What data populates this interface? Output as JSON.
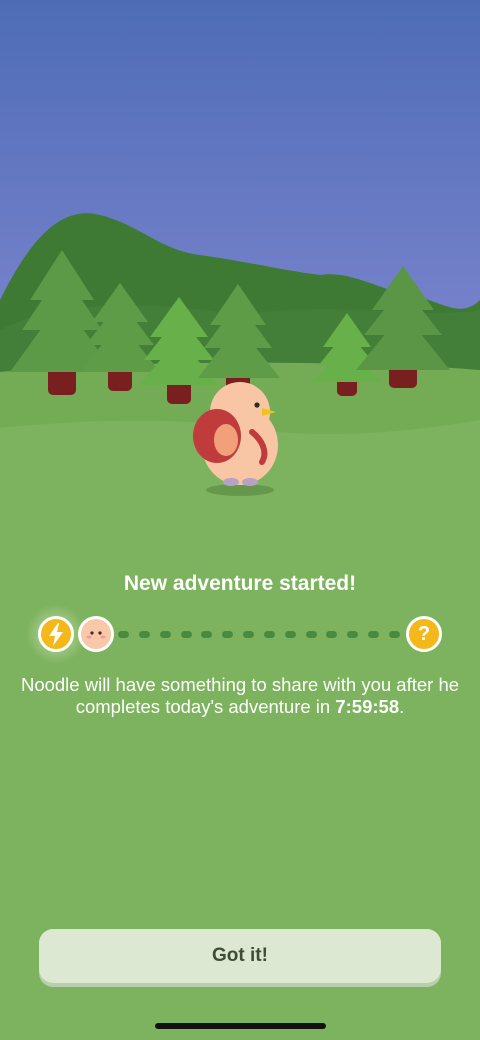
{
  "colors": {
    "sky_top": "#4f6eb8",
    "sky_bottom": "#8c8fd6",
    "hills": "#3d7a35",
    "grass": "#7db35e",
    "accent_yellow": "#f4b81a",
    "chick": "#f8c8a8",
    "backpack": "#c03c3c"
  },
  "adventure": {
    "title": "New adventure started!",
    "message_prefix": "Noodle will have something to share with you after he completes today's adventure in ",
    "timer": "7:59:58",
    "message_suffix": ".",
    "start_icon": "lightning-icon",
    "end_icon": "question-mark-icon",
    "end_icon_glyph": "?"
  },
  "actions": {
    "got_it_label": "Got it!"
  }
}
